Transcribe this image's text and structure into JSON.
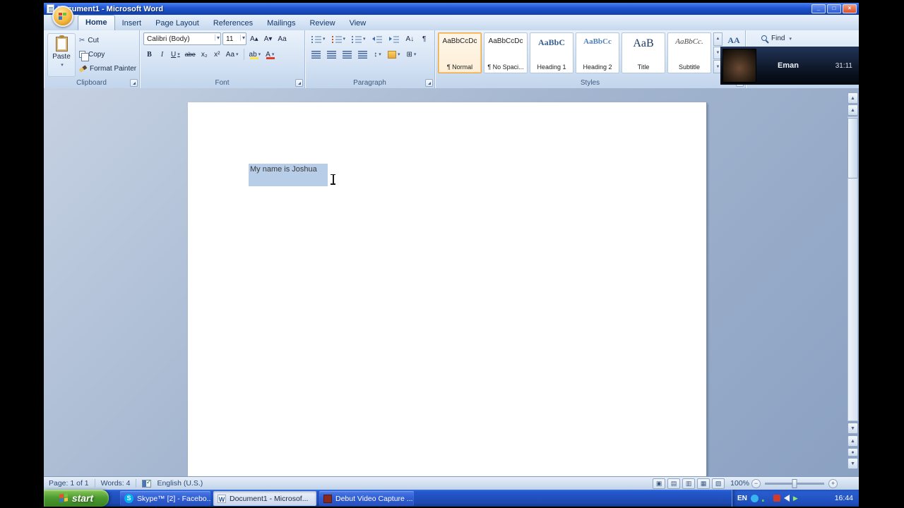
{
  "window": {
    "title": "Document1 - Microsoft Word"
  },
  "icons": {
    "minimize": "_",
    "restore": "□",
    "close": "×",
    "cut": "✂",
    "grow_font": "A▴",
    "shrink_font": "A▾",
    "clear_formatting": "Aa",
    "subscript": "x₂",
    "superscript": "x²",
    "change_case": "Aa",
    "highlight": "ab",
    "font_color": "A",
    "sort": "A↓",
    "pilcrow": "¶",
    "line_spacing": "↕",
    "borders": "⊞",
    "scroll_up": "▲",
    "scroll_down": "▼",
    "browse_prev": "▲",
    "browse_ball": "●",
    "browse_next": "▼",
    "zoom_out": "−",
    "zoom_in": "+",
    "view": [
      "▣",
      "▤",
      "▥",
      "▦",
      "▧"
    ],
    "skype_letter": "S",
    "word_letter": "W",
    "play": "▶"
  },
  "ribbon": {
    "tabs": [
      "Home",
      "Insert",
      "Page Layout",
      "References",
      "Mailings",
      "Review",
      "View"
    ],
    "clipboard": {
      "group_label": "Clipboard",
      "paste": "Paste",
      "cut": "Cut",
      "copy": "Copy",
      "format_painter": "Format Painter"
    },
    "font": {
      "group_label": "Font",
      "font_name": "Calibri (Body)",
      "font_size": "11",
      "bold": "B",
      "italic": "I",
      "underline": "U",
      "strikethrough": "abe"
    },
    "paragraph": {
      "group_label": "Paragraph"
    },
    "styles": {
      "group_label": "Styles",
      "items": [
        {
          "preview": "AaBbCcDc",
          "label": "¶ Normal"
        },
        {
          "preview": "AaBbCcDc",
          "label": "¶ No Spaci..."
        },
        {
          "preview": "AaBbC",
          "label": "Heading 1"
        },
        {
          "preview": "AaBbCc",
          "label": "Heading 2"
        },
        {
          "preview": "AaB",
          "label": "Title"
        },
        {
          "preview": "AaBbCc.",
          "label": "Subtitle"
        }
      ]
    },
    "editing": {
      "find": "Find",
      "change_styles": "AA"
    }
  },
  "overlay": {
    "name": "Eman",
    "time": "31:11"
  },
  "document": {
    "text": "My name is Joshua"
  },
  "status_bar": {
    "page": "Page: 1 of 1",
    "words": "Words: 4",
    "language": "English (U.S.)",
    "zoom": "100%"
  },
  "taskbar": {
    "start": "start",
    "buttons": [
      {
        "label": "Skype™ [2] - Facebo..."
      },
      {
        "label": "Document1 - Microsof..."
      },
      {
        "label": "Debut Video Capture ..."
      }
    ],
    "tray": {
      "language": "EN",
      "time": "16:44"
    }
  }
}
